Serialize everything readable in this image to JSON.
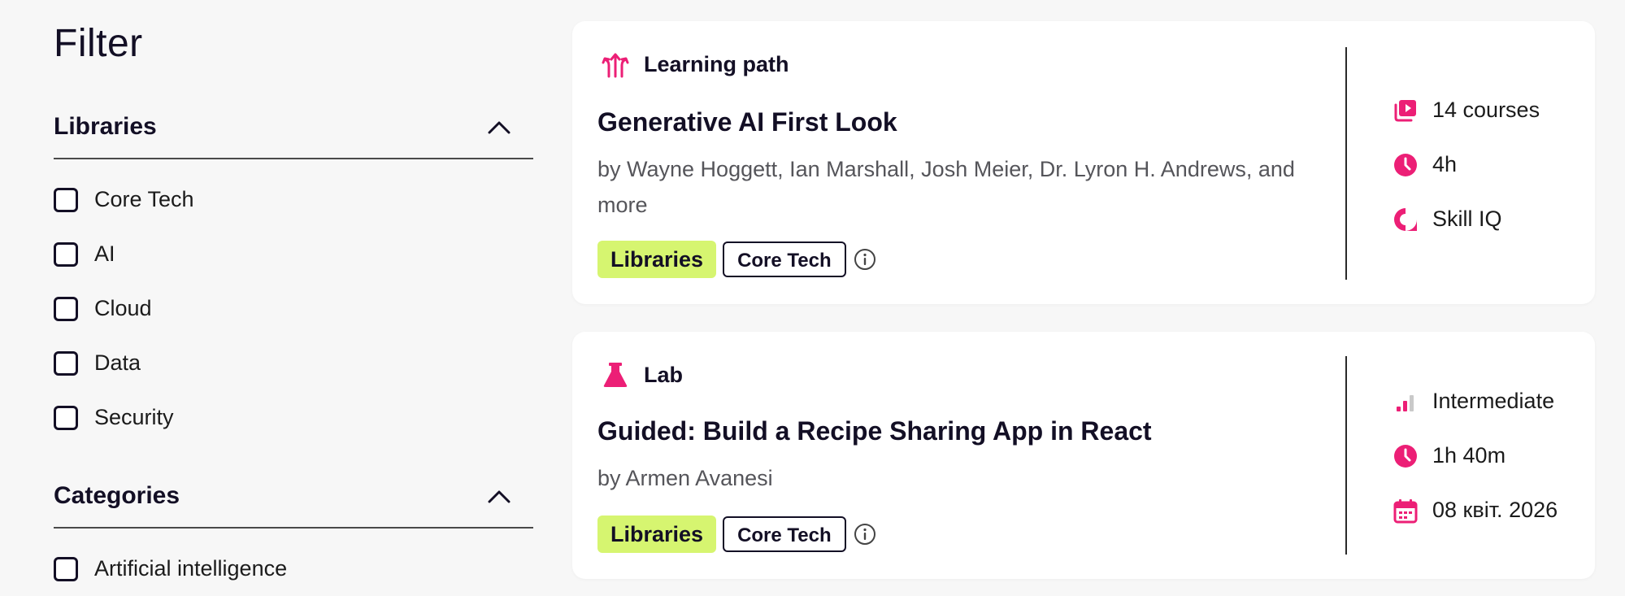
{
  "sidebar": {
    "title": "Filter",
    "libraries": {
      "title": "Libraries",
      "options": [
        "Core Tech",
        "AI",
        "Cloud",
        "Data",
        "Security"
      ]
    },
    "categories": {
      "title": "Categories",
      "options": [
        "Artificial intelligence"
      ]
    }
  },
  "cards": [
    {
      "type": "Learning path",
      "type_icon": "learning-path-icon",
      "title": "Generative AI First Look",
      "authors": "by Wayne Hoggett, Ian Marshall, Josh Meier, Dr. Lyron H. Andrews, and more",
      "tags": [
        "Libraries",
        "Core Tech"
      ],
      "meta": [
        {
          "icon": "courses-icon",
          "text": "14 courses"
        },
        {
          "icon": "clock-icon",
          "text": "4h"
        },
        {
          "icon": "skill-iq-icon",
          "text": "Skill IQ"
        }
      ]
    },
    {
      "type": "Lab",
      "type_icon": "lab-flask-icon",
      "title": "Guided: Build a Recipe Sharing App in React",
      "authors": "by Armen Avanesi",
      "tags": [
        "Libraries",
        "Core Tech"
      ],
      "meta": [
        {
          "icon": "level-bars-icon",
          "text": "Intermediate"
        },
        {
          "icon": "clock-icon",
          "text": "1h 40m"
        },
        {
          "icon": "calendar-icon",
          "text": "08 квіт. 2026"
        }
      ]
    }
  ],
  "colors": {
    "accent": "#ec1f76",
    "tag_library": "#d6f570",
    "text": "#130f25",
    "background": "#f7f7f7"
  }
}
